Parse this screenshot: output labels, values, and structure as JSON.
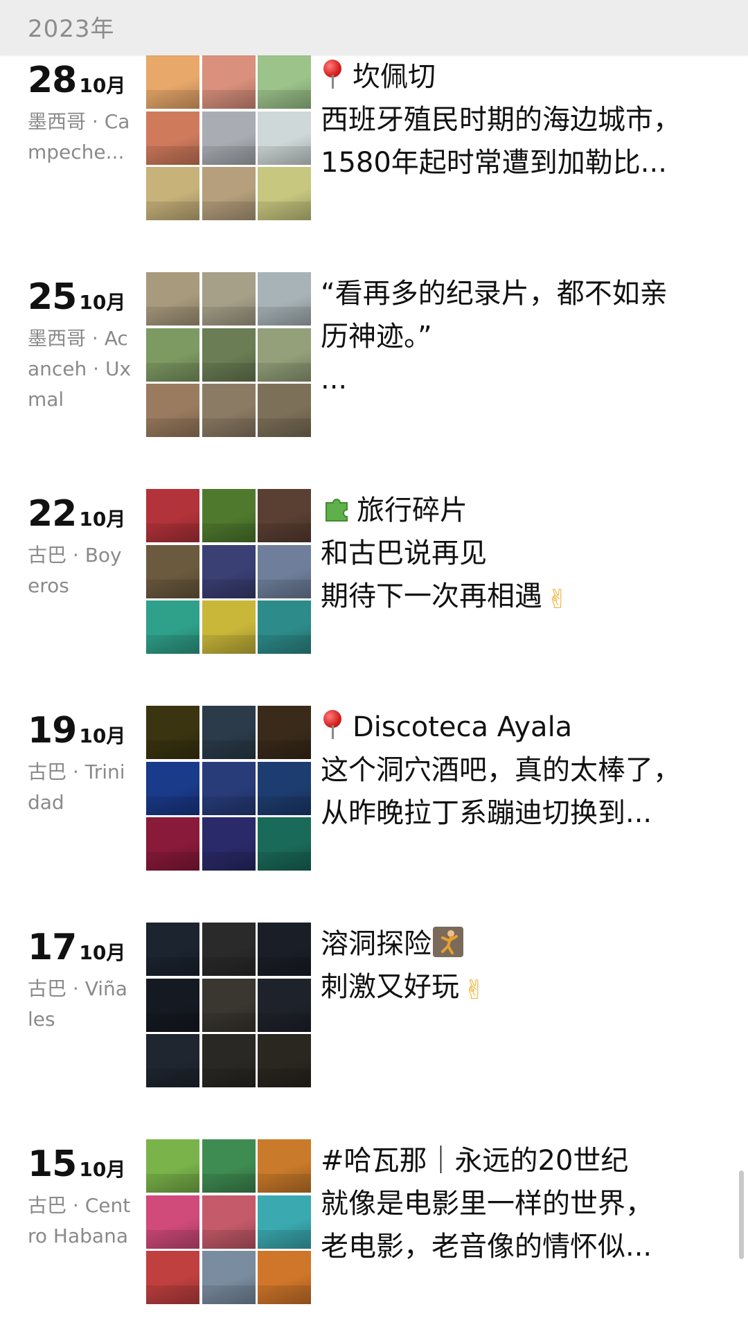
{
  "year_header": {
    "label": "2023年"
  },
  "posts": [
    {
      "day": "28",
      "month": "10月",
      "location": "墨西哥 · Campeche...",
      "lines": [
        "坎佩切",
        "西班牙殖民时期的海边城市，",
        "1580年起时常遭到加勒比..."
      ],
      "leading_icon": "pin",
      "thumbs": [
        "#e8a86a",
        "#d9907c",
        "#9cc38a",
        "#d07a5c",
        "#a9adb3",
        "#cfd8d8",
        "#c7b27a",
        "#b59f7c",
        "#c8c77f"
      ]
    },
    {
      "day": "25",
      "month": "10月",
      "location": "墨西哥 · Acanceh · Uxmal",
      "lines": [
        "“看再多的纪录片，都不如亲",
        "历神迹。”",
        "..."
      ],
      "leading_icon": "",
      "thumbs": [
        "#a89a7d",
        "#a6a089",
        "#a8b3b7",
        "#7e9a63",
        "#6a7d54",
        "#93a07a",
        "#9a7b5f",
        "#8c7b64",
        "#7d7058"
      ]
    },
    {
      "day": "22",
      "month": "10月",
      "location": "古巴 · Boyeros",
      "lines": [
        "旅行碎片",
        "和古巴说再见",
        "期待下一次再相遇"
      ],
      "leading_icon": "puzzle",
      "trailing_icon_line": 2,
      "thumbs": [
        "#b3333a",
        "#4f7a2e",
        "#5a3f33",
        "#6b5a3e",
        "#3a3f74",
        "#6f7f9b",
        "#2fa18a",
        "#c9b73a",
        "#2d8c8a"
      ]
    },
    {
      "day": "19",
      "month": "10月",
      "location": "古巴 · Trinidad",
      "lines": [
        "Discoteca Ayala",
        "这个洞穴酒吧，真的太棒了，",
        "从昨晚拉丁系蹦迪切换到..."
      ],
      "leading_icon": "pin",
      "thumbs": [
        "#3a3410",
        "#2b3b4a",
        "#3a2a1a",
        "#1a3a8a",
        "#283c7a",
        "#1d3d70",
        "#8a1a3a",
        "#2a2a6a",
        "#1a6a5a"
      ]
    },
    {
      "day": "17",
      "month": "10月",
      "location": "古巴 · Viñales",
      "lines": [
        "溶洞探险",
        "刺激又好玩"
      ],
      "leading_icon": "",
      "trailing_icon_line": 1,
      "thumbs": [
        "#1c2430",
        "#2a2a2a",
        "#1a1e26",
        "#151a22",
        "#3a3630",
        "#1e232b",
        "#1f2630",
        "#2a2824",
        "#2a2620"
      ]
    },
    {
      "day": "15",
      "month": "10月",
      "location": "古巴 · Centro Habana",
      "lines": [
        "#哈瓦那｜永远的20世纪",
        "就像是电影里一样的世界，",
        "老电影，老音像的情怀似..."
      ],
      "leading_icon": "",
      "thumbs": [
        "#7ab34a",
        "#3f8c52",
        "#c97a2a",
        "#d04a7a",
        "#c45a6a",
        "#3aa9b0",
        "#c04040",
        "#7a8ca0",
        "#d0762a"
      ]
    }
  ],
  "icons": {
    "pin": "round-pushpin-icon",
    "puzzle": "puzzle-piece-icon",
    "climb": "person-climbing-icon",
    "victory": "victory-hand-icon"
  }
}
